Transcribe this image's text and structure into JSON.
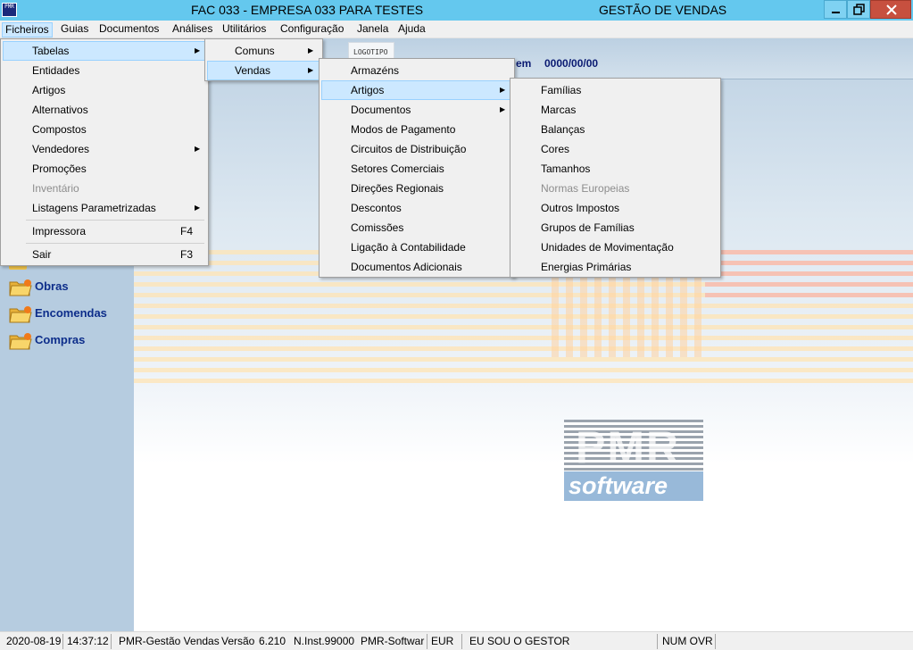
{
  "window": {
    "title_left": "FAC 033 - EMPRESA 033 PARA TESTES",
    "title_right": "GESTÃO DE VENDAS",
    "app_icon_text": "PMR",
    "accent_color": "#64c8ee",
    "close_color": "#c7503f"
  },
  "menubar": {
    "items": [
      {
        "label": "Ficheiros"
      },
      {
        "label": "Guias"
      },
      {
        "label": "Documentos"
      },
      {
        "label": "Análises"
      },
      {
        "label": "Utilitários"
      },
      {
        "label": "Configuração"
      },
      {
        "label": "Janela"
      },
      {
        "label": "Ajuda"
      }
    ]
  },
  "header": {
    "logo_text": "LOGOTIPO",
    "date_label": "a em",
    "date_value": "0000/00/00"
  },
  "menu_ficheiros": {
    "items": [
      {
        "label": "Tabelas",
        "submenu": true
      },
      {
        "label": "Entidades"
      },
      {
        "label": "Artigos"
      },
      {
        "label": "Alternativos"
      },
      {
        "label": "Compostos"
      },
      {
        "label": "Vendedores",
        "submenu": true
      },
      {
        "label": "Promoções"
      },
      {
        "label": "Inventário",
        "disabled": true
      },
      {
        "label": "Listagens Parametrizadas",
        "submenu": true
      },
      {
        "label": "Impressora",
        "shortcut": "F4"
      },
      {
        "label": "Sair",
        "shortcut": "F3"
      }
    ]
  },
  "menu_tabelas": {
    "items": [
      {
        "label": "Comuns",
        "submenu": true
      },
      {
        "label": "Vendas",
        "submenu": true
      }
    ]
  },
  "menu_vendas": {
    "items": [
      {
        "label": "Armazéns"
      },
      {
        "label": "Artigos",
        "submenu": true
      },
      {
        "label": "Documentos",
        "submenu": true
      },
      {
        "label": "Modos de Pagamento"
      },
      {
        "label": "Circuitos de Distribuição"
      },
      {
        "label": "Setores Comerciais"
      },
      {
        "label": "Direções Regionais"
      },
      {
        "label": "Descontos"
      },
      {
        "label": "Comissões"
      },
      {
        "label": "Ligação à Contabilidade"
      },
      {
        "label": "Documentos Adicionais"
      }
    ]
  },
  "menu_artigos": {
    "items": [
      {
        "label": "Famílias"
      },
      {
        "label": "Marcas"
      },
      {
        "label": "Balanças"
      },
      {
        "label": "Cores"
      },
      {
        "label": "Tamanhos"
      },
      {
        "label": "Normas Europeias",
        "disabled": true
      },
      {
        "label": "Outros Impostos"
      },
      {
        "label": "Grupos de Famílias"
      },
      {
        "label": "Unidades de Movimentação"
      },
      {
        "label": "Energias Primárias"
      }
    ]
  },
  "sidebar": {
    "items": [
      {
        "label": "Obras",
        "icon": "folder-icon"
      },
      {
        "label": "Encomendas",
        "icon": "folder-icon"
      },
      {
        "label": "Compras",
        "icon": "folder-icon"
      }
    ]
  },
  "brand": {
    "pmr": "PMR",
    "software": "software"
  },
  "statusbar": {
    "date": "2020-08-19",
    "time": "14:37:12",
    "app": "PMR-Gestão Vendas",
    "version_label": "Versão",
    "version": "6.210",
    "instance": "N.Inst.99000",
    "vendor": "PMR-Softwar",
    "currency": "EUR",
    "user": "EU SOU O GESTOR",
    "keys": "NUM OVR"
  }
}
